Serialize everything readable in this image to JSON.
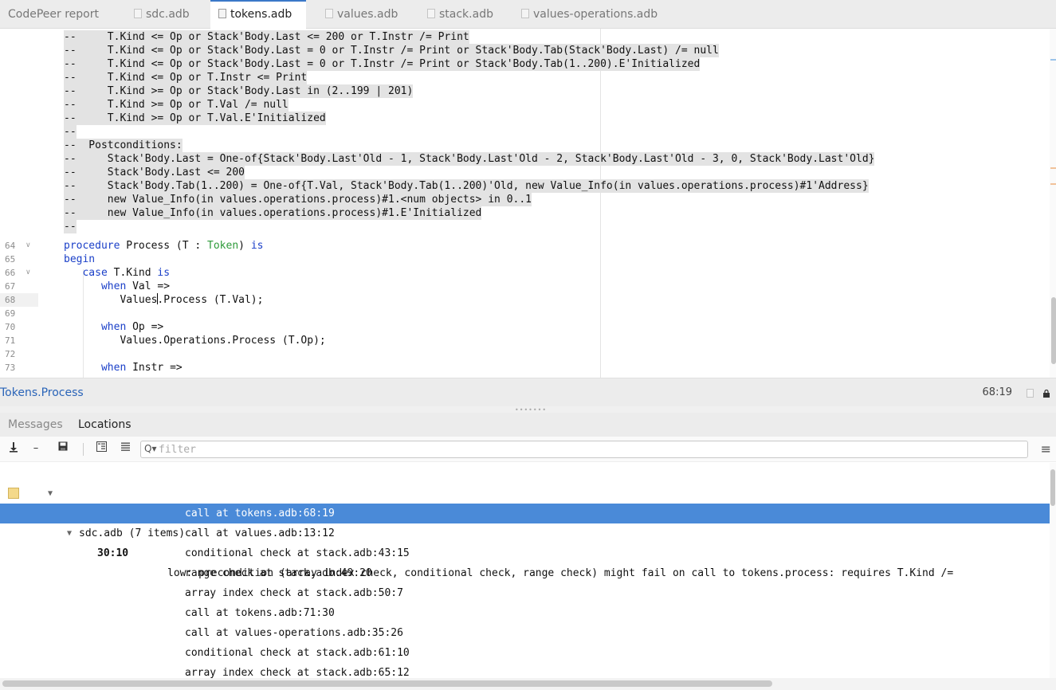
{
  "tabs": [
    {
      "label": "CodePeer report",
      "icon": "",
      "active": false
    },
    {
      "label": "sdc.adb",
      "icon": "file-icon",
      "active": false
    },
    {
      "label": "tokens.adb",
      "icon": "file-icon",
      "active": true
    },
    {
      "label": "values.adb",
      "icon": "file-icon",
      "active": false
    },
    {
      "label": "stack.adb",
      "icon": "file-icon",
      "active": false
    },
    {
      "label": "values-operations.adb",
      "icon": "file-icon",
      "active": false
    }
  ],
  "editor": {
    "comment_lines": [
      "--     T.Kind <= Op or Stack'Body.Last <= 200 or T.Instr /= Print",
      "--     T.Kind <= Op or Stack'Body.Last = 0 or T.Instr /= Print or Stack'Body.Tab(Stack'Body.Last) /= null",
      "--     T.Kind <= Op or Stack'Body.Last = 0 or T.Instr /= Print or Stack'Body.Tab(1..200).E'Initialized",
      "--     T.Kind <= Op or T.Instr <= Print",
      "--     T.Kind >= Op or Stack'Body.Last in (2..199 | 201)",
      "--     T.Kind >= Op or T.Val /= null",
      "--     T.Kind >= Op or T.Val.E'Initialized",
      "--",
      "--  Postconditions:",
      "--     Stack'Body.Last = One-of{Stack'Body.Last'Old - 1, Stack'Body.Last'Old - 2, Stack'Body.Last'Old - 3, 0, Stack'Body.Last'Old}",
      "--     Stack'Body.Last <= 200",
      "--     Stack'Body.Tab(1..200) = One-of{T.Val, Stack'Body.Tab(1..200)'Old, new Value_Info(in values.operations.process)#1'Address}",
      "--     new Value_Info(in values.operations.process)#1.<num objects> in 0..1",
      "--     new Value_Info(in values.operations.process)#1.E'Initialized",
      "--"
    ],
    "line_numbers": [
      "64",
      "65",
      "66",
      "67",
      "68",
      "69",
      "70",
      "71",
      "72",
      "73"
    ],
    "code": {
      "l64_kw1": "procedure",
      "l64_a": " Process (T : ",
      "l64_type": "Token",
      "l64_b": ") ",
      "l64_kw2": "is",
      "l65_kw": "begin",
      "l66_ind": "   ",
      "l66_kw1": "case",
      "l66_a": " T.Kind ",
      "l66_kw2": "is",
      "l67_ind": "      ",
      "l67_kw": "when",
      "l67_a": " Val =>",
      "l68_a": "         Values",
      "l68_b": ".Process (T.Val);",
      "l70_ind": "      ",
      "l70_kw": "when",
      "l70_a": " Op =>",
      "l71_a": "         Values.Operations.Process (T.Op);",
      "l73_ind": "      ",
      "l73_kw": "when",
      "l73_a": " Instr =>"
    },
    "colors": {
      "keyword": "#1a3fc8",
      "type": "#2e9a3a",
      "comment_bg": "#e3e3e3"
    }
  },
  "status": {
    "location": "Tokens.Process",
    "position": "68:19"
  },
  "panel": {
    "tabs": [
      "Messages",
      "Locations"
    ],
    "active_tab": "Locations",
    "filter_placeholder": "filter",
    "group_label": "sdc.adb (7 items)",
    "message": {
      "position": "30:10",
      "text": "low: precondition (array index check, conditional check, range check) might fail on call to tokens.process: requires T.Kind /="
    },
    "details": [
      "call at tokens.adb:68:19",
      "call at values.adb:13:12",
      "conditional check at stack.adb:43:15",
      "range check at stack.adb:49:20",
      "array index check at stack.adb:50:7",
      "call at tokens.adb:71:30",
      "call at values-operations.adb:35:26",
      "conditional check at stack.adb:61:10",
      "array index check at stack.adb:65:12"
    ],
    "selected_index": 0,
    "selection_color": "#4a8ad8"
  }
}
